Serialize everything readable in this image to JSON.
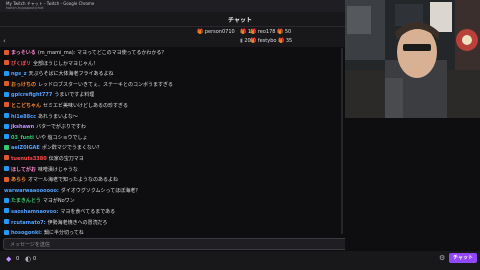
{
  "window": {
    "title": "My Twitch チャット - Twitch - Google Chrome",
    "url": "twitch.tv/popout/chat"
  },
  "chat": {
    "title": "チャット",
    "input_placeholder": "メッセージを送信",
    "send_label": "チャット"
  },
  "leaderboard": [
    {
      "name": "person0710",
      "count": "10",
      "sub": "200"
    },
    {
      "name": "reo178",
      "count": "50",
      "sub": ""
    },
    {
      "name": "festybo",
      "count": "35",
      "sub": ""
    }
  ],
  "messages": [
    {
      "user": "まっそいる",
      "color": "#ff8ad0",
      "badge": "#e05a2b",
      "text": "(m_mami_ma): マヨってどこのマヨ使ってるかわかる？"
    },
    {
      "user": "ぴくぽリ",
      "color": "#ff4c4c",
      "badge": "#e05a2b",
      "text": "全部ほうじしかマヨじゃん！"
    },
    {
      "user": "ngs_z",
      "color": "#4fa3ff",
      "badge": "#1f9aff",
      "text": "天ぷらそばに大体海老フライあるよね"
    },
    {
      "user": "おっけちの",
      "color": "#ff8c2b",
      "badge": "#e05a2b",
      "text": "レッドロブスターいきてぇ、ステーキとのコンボうますぎる"
    },
    {
      "user": "gpicrefight777",
      "color": "#4fa3ff",
      "badge": "#1f9aff",
      "text": "うまいですよ料理"
    },
    {
      "user": "とこどちゃん",
      "color": "#ff8c2b",
      "badge": "#e05a2b",
      "text": "セミエビ美味いけどしあるの珍すぎる"
    },
    {
      "user": "hi1e88cc",
      "color": "#4fa3ff",
      "badge": "#1f9aff",
      "text": "あれうまいよな～"
    },
    {
      "user": "jkshawn",
      "color": "#bf94ff",
      "badge": "#1f9aff",
      "text": "バターでがぶりですわ"
    },
    {
      "user": "03_funti",
      "color": "#2ecc71",
      "badge": "#1f9aff",
      "text": "いや 塩コショウでしょ"
    },
    {
      "user": "aeiZ0IGAE",
      "color": "#4fa3ff",
      "badge": "#2ecc71",
      "text": "ポン酢マジでうまくない？"
    },
    {
      "user": "tuenuts3380",
      "color": "#ff4c4c",
      "badge": "#e05a2b",
      "text": "伝家の宝刀マヨ"
    },
    {
      "user": "ほしてがお",
      "color": "#ff8ad0",
      "badge": "#1f9aff",
      "text": "味噌漬けじゃうな"
    },
    {
      "user": "あらら",
      "color": "#ff8c2b",
      "badge": "#e05a2b",
      "text": "オマール海老で知ったようなのあるよね"
    },
    {
      "user": "warwarwaaoooooo:",
      "color": "#4fa3ff",
      "badge": "",
      "text": "ダイオウグソクムシってほぼ海老？"
    },
    {
      "user": "たまきんとう",
      "color": "#2ecc71",
      "badge": "#1f9aff",
      "text": "マヨがNoワン"
    },
    {
      "user": "saoshamnaovoo:",
      "color": "#4fa3ff",
      "badge": "#1f9aff",
      "text": "マヨを食べてるまである"
    },
    {
      "user": "rcutamato7:",
      "color": "#4fa3ff",
      "badge": "#1f9aff",
      "text": "伊勢海老焼きへの冒涜だろ"
    },
    {
      "user": "hosogonki:",
      "color": "#4fa3ff",
      "badge": "#1f9aff",
      "text": "鍋に半分切ってね"
    }
  ],
  "footer": {
    "points": "0",
    "subs": "0"
  }
}
